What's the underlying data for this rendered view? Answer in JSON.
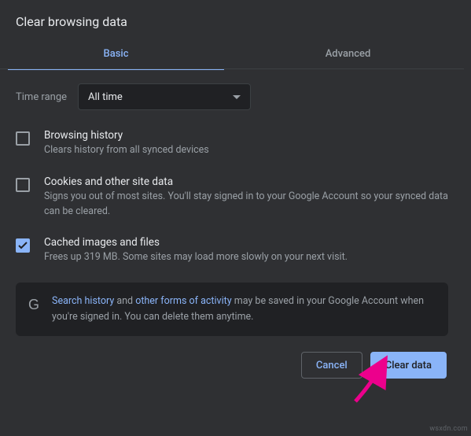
{
  "dialog": {
    "title": "Clear browsing data",
    "tabs": {
      "basic": "Basic",
      "advanced": "Advanced"
    },
    "time_range": {
      "label": "Time range",
      "value": "All time"
    },
    "options": [
      {
        "checked": false,
        "title": "Browsing history",
        "desc": "Clears history from all synced devices"
      },
      {
        "checked": false,
        "title": "Cookies and other site data",
        "desc": "Signs you out of most sites. You'll stay signed in to your Google Account so your synced data can be cleared."
      },
      {
        "checked": true,
        "title": "Cached images and files",
        "desc": "Frees up 319 MB. Some sites may load more slowly on your next visit."
      }
    ],
    "info": {
      "link1": "Search history",
      "mid1": " and ",
      "link2": "other forms of activity",
      "rest": " may be saved in your Google Account when you're signed in. You can delete them anytime."
    },
    "actions": {
      "cancel": "Cancel",
      "clear": "Clear data"
    }
  },
  "watermark": "wsxdn.com"
}
